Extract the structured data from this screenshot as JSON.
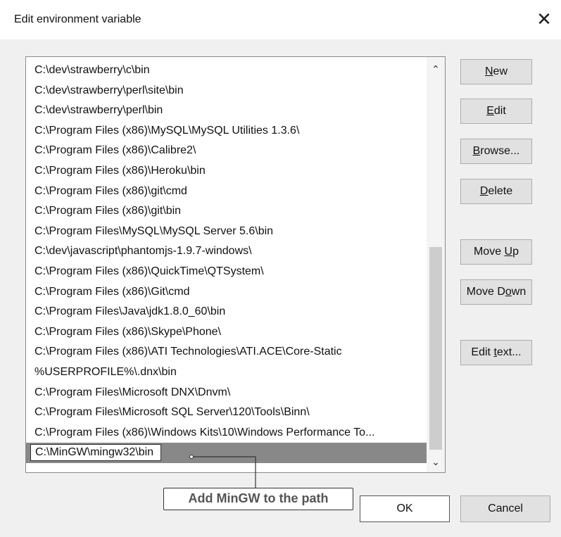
{
  "window": {
    "title": "Edit environment variable",
    "close_glyph": "✕"
  },
  "list": {
    "items": [
      "C:\\dev\\strawberry\\c\\bin",
      "C:\\dev\\strawberry\\perl\\site\\bin",
      "C:\\dev\\strawberry\\perl\\bin",
      "C:\\Program Files (x86)\\MySQL\\MySQL Utilities 1.3.6\\",
      "C:\\Program Files (x86)\\Calibre2\\",
      "C:\\Program Files (x86)\\Heroku\\bin",
      "C:\\Program Files (x86)\\git\\cmd",
      "C:\\Program Files (x86)\\git\\bin",
      "C:\\Program Files\\MySQL\\MySQL Server 5.6\\bin",
      "C:\\dev\\javascript\\phantomjs-1.9.7-windows\\",
      "C:\\Program Files (x86)\\QuickTime\\QTSystem\\",
      "C:\\Program Files (x86)\\Git\\cmd",
      "C:\\Program Files\\Java\\jdk1.8.0_60\\bin",
      "C:\\Program Files (x86)\\Skype\\Phone\\",
      "C:\\Program Files (x86)\\ATI Technologies\\ATI.ACE\\Core-Static",
      "%USERPROFILE%\\.dnx\\bin",
      "C:\\Program Files\\Microsoft DNX\\Dnvm\\",
      "C:\\Program Files\\Microsoft SQL Server\\120\\Tools\\Binn\\",
      "C:\\Program Files (x86)\\Windows Kits\\10\\Windows Performance To..."
    ],
    "editing_value": "C:\\MinGW\\mingw32\\bin",
    "scroll_up_glyph": "⌃",
    "scroll_down_glyph": "⌄"
  },
  "buttons": {
    "new": {
      "pre": "",
      "mnemonic": "N",
      "post": "ew"
    },
    "edit": {
      "pre": "",
      "mnemonic": "E",
      "post": "dit"
    },
    "browse": {
      "pre": "",
      "mnemonic": "B",
      "post": "rowse..."
    },
    "delete": {
      "pre": "",
      "mnemonic": "D",
      "post": "elete"
    },
    "move_up": {
      "pre": "Move ",
      "mnemonic": "U",
      "post": "p"
    },
    "move_down": {
      "pre": "Move D",
      "mnemonic": "o",
      "post": "wn"
    },
    "edit_text": {
      "pre": "Edit ",
      "mnemonic": "t",
      "post": "ext..."
    },
    "ok": "OK",
    "cancel": "Cancel"
  },
  "callout": {
    "text": "Add MinGW to the path"
  },
  "colors": {
    "selected_row": "#888888",
    "dialog_bg": "#f0f0f0",
    "button_bg": "#e1e1e1"
  }
}
